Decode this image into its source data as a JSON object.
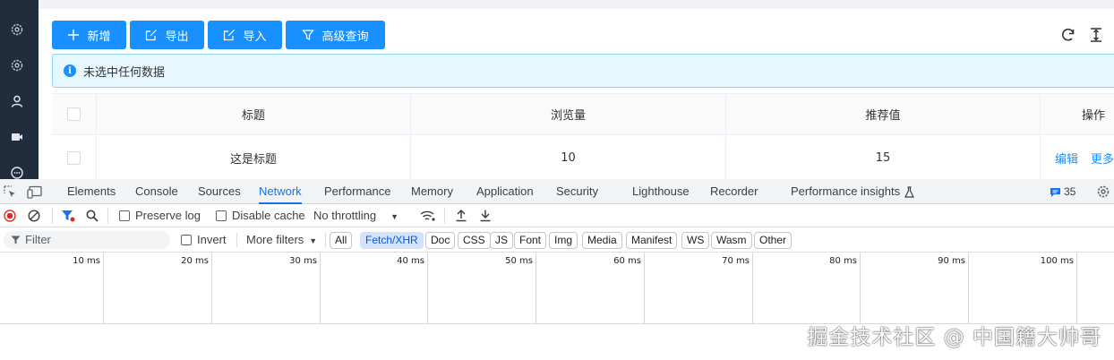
{
  "app": {
    "buttons": {
      "add": "新增",
      "export": "导出",
      "import": "导入",
      "advanced_query": "高级查询"
    },
    "alert": {
      "text": "未选中任何数据"
    },
    "table": {
      "columns": [
        "标题",
        "浏览量",
        "推荐值",
        "操作"
      ],
      "rows": [
        {
          "title": "这是标题",
          "views": "10",
          "recommend": "15",
          "actions": [
            "编辑",
            "更多"
          ]
        }
      ]
    },
    "sidebar_icons": [
      "gear-icon",
      "gear-icon",
      "user-icon",
      "video-icon",
      "chat-icon"
    ],
    "colors": {
      "primary": "#1890ff",
      "sidebar": "#1f2d3d",
      "alert_bg": "#e6f7ff"
    }
  },
  "devtools": {
    "tabs": [
      "Elements",
      "Console",
      "Sources",
      "Network",
      "Performance",
      "Memory",
      "Application",
      "Security",
      "Lighthouse",
      "Recorder",
      "Performance insights"
    ],
    "active_tab": "Network",
    "issues_count": "35",
    "toolbar": {
      "preserve_log": "Preserve log",
      "disable_cache": "Disable cache",
      "throttling": "No throttling"
    },
    "filter": {
      "placeholder": "Filter",
      "invert": "Invert",
      "more_filters": "More filters",
      "types": [
        "All",
        "Fetch/XHR",
        "Doc",
        "CSS",
        "JS",
        "Font",
        "Img",
        "Media",
        "Manifest",
        "WS",
        "Wasm",
        "Other"
      ],
      "active_type": "Fetch/XHR"
    },
    "timeline_ticks": [
      "10 ms",
      "20 ms",
      "30 ms",
      "40 ms",
      "50 ms",
      "60 ms",
      "70 ms",
      "80 ms",
      "90 ms",
      "100 ms"
    ]
  },
  "watermark": "掘金技术社区 @ 中国籍大帅哥"
}
